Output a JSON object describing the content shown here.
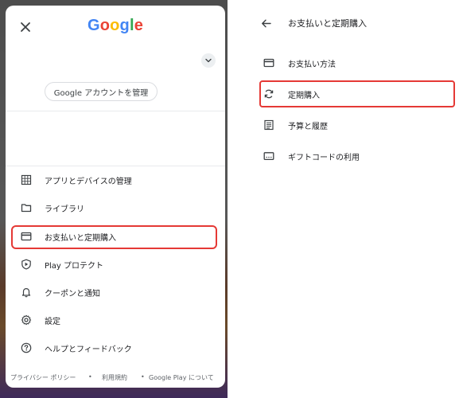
{
  "drawer": {
    "logo_letters": [
      "G",
      "o",
      "o",
      "g",
      "l",
      "e"
    ],
    "account_button_label": "Google アカウントを管理",
    "menu_items": [
      {
        "label": "アプリとデバイスの管理",
        "icon": "grid-icon"
      },
      {
        "label": "ライブラリ",
        "icon": "folder-icon"
      },
      {
        "label": "お支払いと定期購入",
        "icon": "credit-card-icon"
      },
      {
        "label": "Play プロテクト",
        "icon": "shield-play-icon"
      },
      {
        "label": "クーポンと通知",
        "icon": "bell-icon"
      },
      {
        "label": "設定",
        "icon": "gear-icon"
      },
      {
        "label": "ヘルプとフィードバック",
        "icon": "help-circle-icon"
      }
    ],
    "footer": {
      "privacy": "プライバシー ポリシー",
      "sep1": "•",
      "terms": "利用規約",
      "sep2": "•",
      "about": "Google Play について"
    }
  },
  "payments_page": {
    "title": "お支払いと定期購入",
    "items": [
      {
        "label": "お支払い方法",
        "icon": "credit-card-icon"
      },
      {
        "label": "定期購入",
        "icon": "refresh-icon"
      },
      {
        "label": "予算と履歴",
        "icon": "list-icon"
      },
      {
        "label": "ギフトコードの利用",
        "icon": "gift-card-icon"
      }
    ]
  },
  "colors": {
    "highlight": "#e53935",
    "text": "#202124",
    "google_blue": "#4285F4",
    "google_red": "#EA4335",
    "google_yellow": "#FBBC05",
    "google_green": "#34A853"
  }
}
